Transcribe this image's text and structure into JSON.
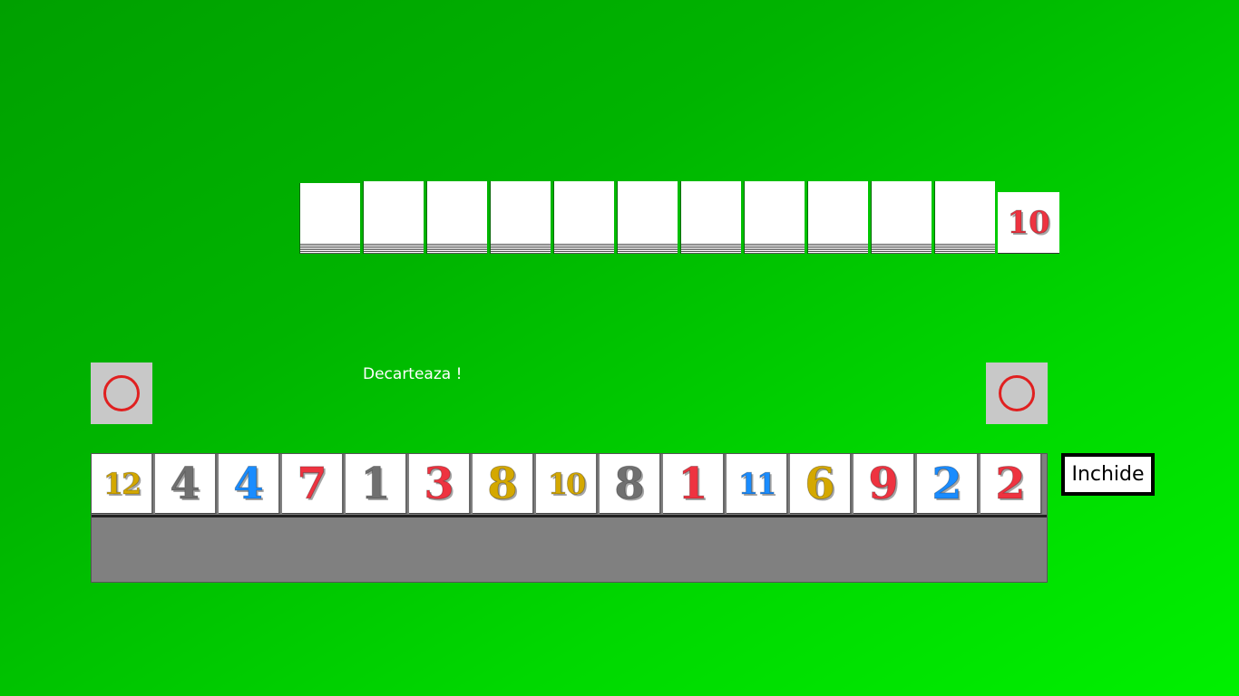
{
  "opponent_stack": {
    "count": 11
  },
  "discard_top": {
    "number": "10",
    "color": "#ee3340"
  },
  "left_button": {
    "icon": "circle-icon",
    "ring_color": "#e02020"
  },
  "right_button": {
    "icon": "circle-icon",
    "ring_color": "#e02020"
  },
  "status_text": "Decarteaza !",
  "close_button": {
    "label": "Inchide"
  },
  "rack": {
    "tiles": [
      {
        "number": "12",
        "color": "#d4a800"
      },
      {
        "number": "4",
        "color": "#707070"
      },
      {
        "number": "4",
        "color": "#1a8cff"
      },
      {
        "number": "7",
        "color": "#ee3340"
      },
      {
        "number": "1",
        "color": "#707070"
      },
      {
        "number": "3",
        "color": "#ee3340"
      },
      {
        "number": "8",
        "color": "#d4a800"
      },
      {
        "number": "10",
        "color": "#d4a800"
      },
      {
        "number": "8",
        "color": "#707070"
      },
      {
        "number": "1",
        "color": "#ee3340"
      },
      {
        "number": "11",
        "color": "#1a8cff"
      },
      {
        "number": "6",
        "color": "#d4a800"
      },
      {
        "number": "9",
        "color": "#ee3340"
      },
      {
        "number": "2",
        "color": "#1a8cff"
      },
      {
        "number": "2",
        "color": "#ee3340"
      }
    ]
  }
}
